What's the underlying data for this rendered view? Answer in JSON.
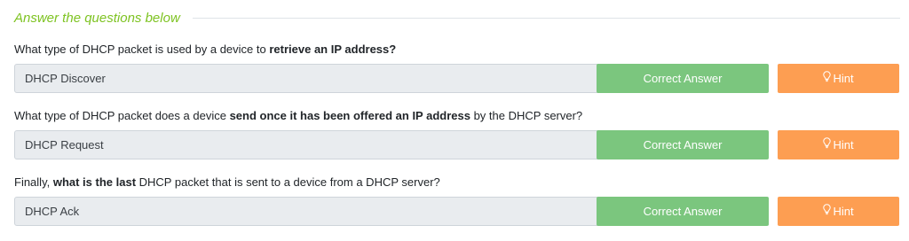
{
  "section": {
    "title": "Answer the questions below"
  },
  "colors": {
    "accent_green_text": "#7ec322",
    "correct_button": "#7bc67e",
    "hint_button": "#fd9e52",
    "answer_box_bg": "#e9ecef"
  },
  "questions": [
    {
      "prefix": "What type of DHCP packet is used by a device to ",
      "bold": "retrieve an IP address?",
      "suffix": "",
      "answer": "DHCP Discover",
      "correct_label": "Correct Answer",
      "hint_label": "Hint",
      "hint_icon": "lightbulb-icon"
    },
    {
      "prefix": "What type of DHCP packet does a device ",
      "bold": "send once it has been offered an IP address",
      "suffix": " by the DHCP server?",
      "answer": "DHCP Request",
      "correct_label": "Correct Answer",
      "hint_label": "Hint",
      "hint_icon": "lightbulb-icon"
    },
    {
      "prefix": "Finally, ",
      "bold": "what is the last",
      "suffix": " DHCP packet that is sent to a device from a DHCP server?",
      "answer": "DHCP Ack",
      "correct_label": "Correct Answer",
      "hint_label": "Hint",
      "hint_icon": "lightbulb-icon"
    }
  ]
}
